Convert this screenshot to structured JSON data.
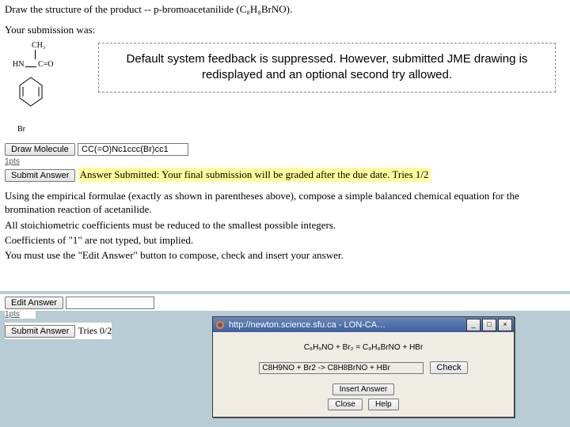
{
  "prompt1": "Draw the structure of the product -- p-bromoacetanilide (C₈H₈BrNO).",
  "submission_label": "Your submission was:",
  "molecule": {
    "ch3": "CH₃",
    "hn": "HN",
    "co": "C=O",
    "br": "Br"
  },
  "callout": "Default system feedback is suppressed.  However, submitted JME drawing is redisplayed and an optional second try allowed.",
  "draw_btn": "Draw Molecule",
  "smiles": "CC(=O)Nc1ccc(Br)cc1",
  "pts1": "1pts",
  "submit_btn": "Submit Answer",
  "feedback": "Answer Submitted: Your final submission will be graded after the due date. Tries 1/2",
  "prompt2": "Using the empirical formulae (exactly as shown in parentheses above), compose a simple balanced chemical equation for the bromination reaction of acetanilide.",
  "note1": "All stoichiometric coefficients must be reduced to the smallest possible integers.",
  "note2": "Coefficients of \"1\" are not typed, but implied.",
  "note3": "You must use the \"Edit Answer\" button to compose, check and insert your answer.",
  "edit_btn": "Edit Answer",
  "pts2": "1pts",
  "tries2": "Tries 0/2",
  "popup": {
    "title": "http://newton.science.sfu.ca - LON-CA…",
    "equation": "C₈H₉NO + Br₂ = C₈H₈BrNO + HBr",
    "input_value": "C8H9NO + Br2 -> C8H8BrNO + HBr",
    "check_btn": "Check",
    "insert_btn": "Insert Answer",
    "close_btn": "Close",
    "help_btn": "Help",
    "min": "_",
    "max": "□",
    "close": "×"
  }
}
